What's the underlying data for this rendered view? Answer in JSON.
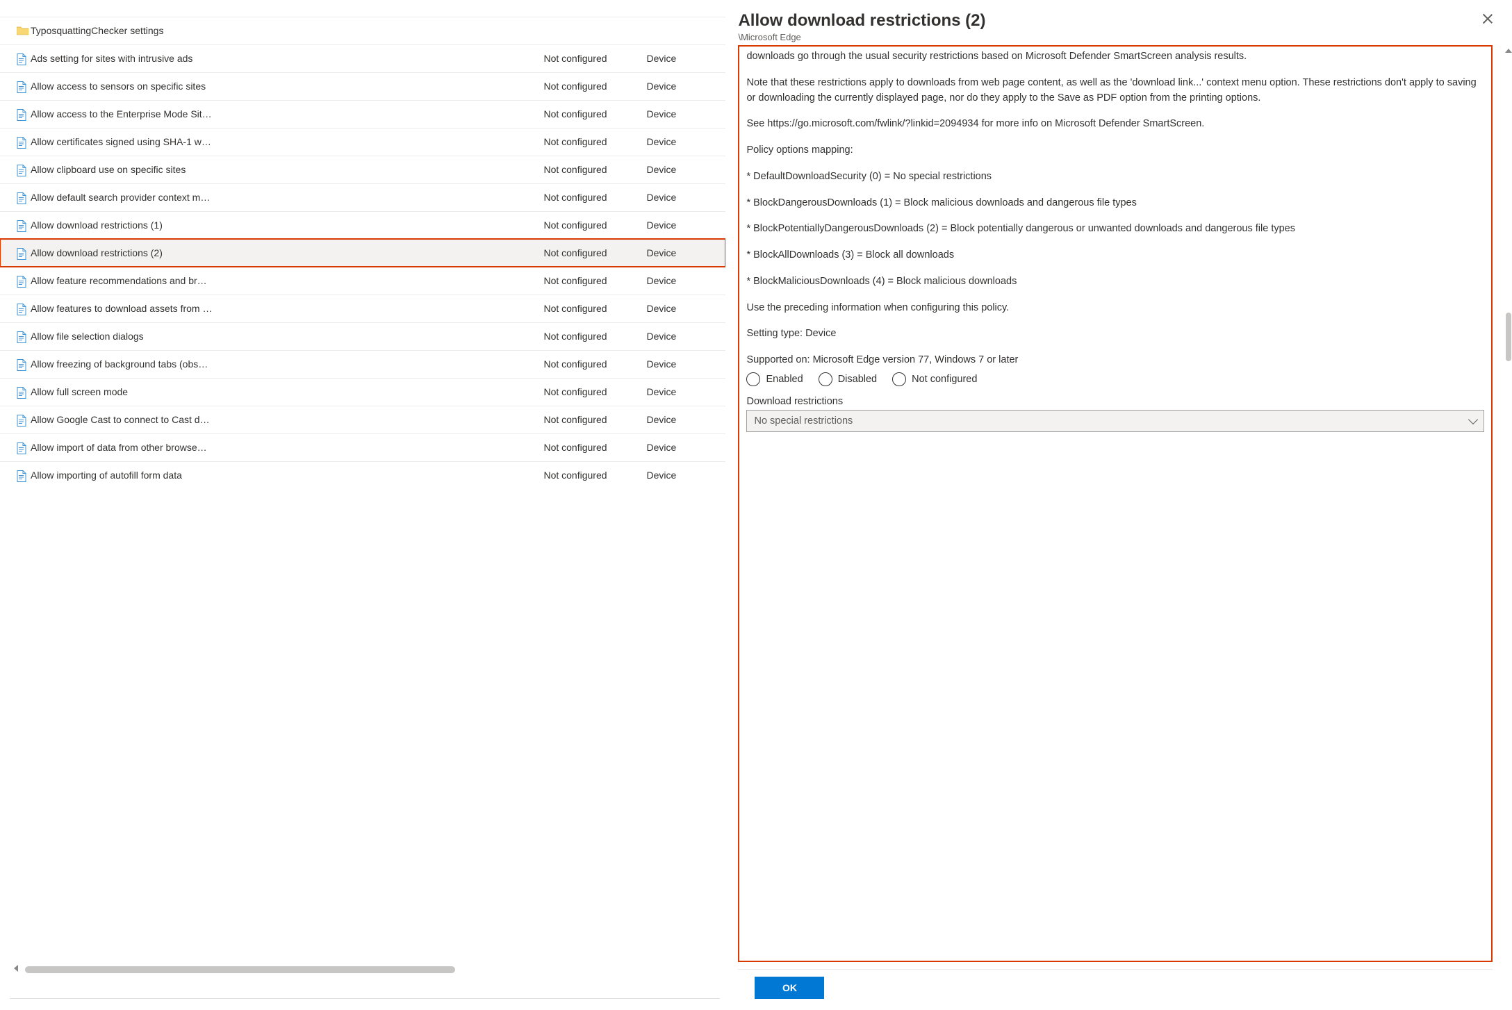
{
  "panel": {
    "title": "Allow download restrictions (2)",
    "breadcrumb": "\\Microsoft Edge",
    "description_parts": {
      "p1": "downloads go through the usual security restrictions based on Microsoft Defender SmartScreen analysis results.",
      "p2": "Note that these restrictions apply to downloads from web page content, as well as the 'download link...' context menu option. These restrictions don't apply to saving or downloading the currently displayed page, nor do they apply to the Save as PDF option from the printing options.",
      "p3": "See https://go.microsoft.com/fwlink/?linkid=2094934 for more info on Microsoft Defender SmartScreen.",
      "map_heading": "Policy options mapping:",
      "m0": "* DefaultDownloadSecurity (0) = No special restrictions",
      "m1": "* BlockDangerousDownloads (1) = Block malicious downloads and dangerous file types",
      "m2": "* BlockPotentiallyDangerousDownloads (2) = Block potentially dangerous or unwanted downloads and dangerous file types",
      "m3": "* BlockAllDownloads (3) = Block all downloads",
      "m4": "* BlockMaliciousDownloads (4) = Block malicious downloads",
      "p4": "Use the preceding information when configuring this policy.",
      "setting_type": "Setting type: Device",
      "supported_on": "Supported on: Microsoft Edge version 77, Windows 7 or later"
    },
    "radios": {
      "enabled": "Enabled",
      "disabled": "Disabled",
      "not_configured": "Not configured"
    },
    "dropdown": {
      "label": "Download restrictions",
      "selected": "No special restrictions"
    },
    "ok_label": "OK"
  },
  "settings": {
    "rows": [
      {
        "kind": "folder",
        "name": "TyposquattingChecker settings",
        "state": "",
        "scope": ""
      },
      {
        "kind": "setting",
        "name": "Ads setting for sites with intrusive ads",
        "state": "Not configured",
        "scope": "Device"
      },
      {
        "kind": "setting",
        "name": "Allow access to sensors on specific sites",
        "state": "Not configured",
        "scope": "Device"
      },
      {
        "kind": "setting",
        "name": "Allow access to the Enterprise Mode Sit…",
        "state": "Not configured",
        "scope": "Device"
      },
      {
        "kind": "setting",
        "name": "Allow certificates signed using SHA-1 w…",
        "state": "Not configured",
        "scope": "Device"
      },
      {
        "kind": "setting",
        "name": "Allow clipboard use on specific sites",
        "state": "Not configured",
        "scope": "Device"
      },
      {
        "kind": "setting",
        "name": "Allow default search provider context m…",
        "state": "Not configured",
        "scope": "Device"
      },
      {
        "kind": "setting",
        "name": "Allow download restrictions (1)",
        "state": "Not configured",
        "scope": "Device"
      },
      {
        "kind": "setting",
        "name": "Allow download restrictions (2)",
        "state": "Not configured",
        "scope": "Device",
        "selected": true,
        "highlighted": true
      },
      {
        "kind": "setting",
        "name": "Allow feature recommendations and br…",
        "state": "Not configured",
        "scope": "Device"
      },
      {
        "kind": "setting",
        "name": "Allow features to download assets from …",
        "state": "Not configured",
        "scope": "Device"
      },
      {
        "kind": "setting",
        "name": "Allow file selection dialogs",
        "state": "Not configured",
        "scope": "Device"
      },
      {
        "kind": "setting",
        "name": "Allow freezing of background tabs (obs…",
        "state": "Not configured",
        "scope": "Device"
      },
      {
        "kind": "setting",
        "name": "Allow full screen mode",
        "state": "Not configured",
        "scope": "Device"
      },
      {
        "kind": "setting",
        "name": "Allow Google Cast to connect to Cast d…",
        "state": "Not configured",
        "scope": "Device"
      },
      {
        "kind": "setting",
        "name": "Allow import of data from other browse…",
        "state": "Not configured",
        "scope": "Device"
      },
      {
        "kind": "setting",
        "name": "Allow importing of autofill form data",
        "state": "Not configured",
        "scope": "Device"
      }
    ]
  }
}
